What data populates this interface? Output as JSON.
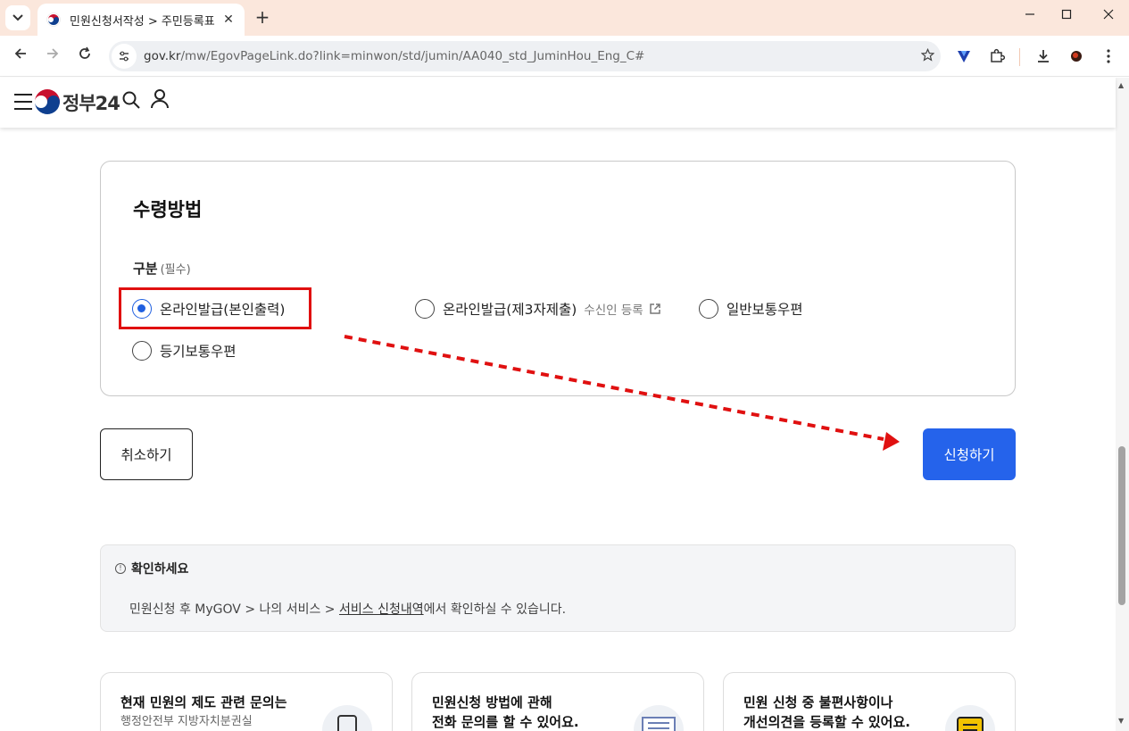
{
  "browser": {
    "tab_title": "민원신청서작성 > 주민등록표",
    "tab_close": "✕",
    "new_tab": "+",
    "url_host": "gov.kr",
    "url_path": "/mw/EgovPageLink.do?link=minwon/std/jumin/AA040_std_JuminHou_Eng_C#"
  },
  "header": {
    "logo_text": "정부24"
  },
  "receipt": {
    "title": "수령방법",
    "field_label": "구분",
    "required": "(필수)",
    "options": [
      {
        "label": "온라인발급(본인출력)",
        "checked": true
      },
      {
        "label": "온라인발급(제3자제출)",
        "sub": "수신인 등록",
        "checked": false
      },
      {
        "label": "일반보통우편",
        "checked": false
      },
      {
        "label": "등기보통우편",
        "checked": false
      }
    ]
  },
  "buttons": {
    "cancel": "취소하기",
    "submit": "신청하기"
  },
  "notice": {
    "title": "확인하세요",
    "body_prefix": "민원신청 후 MyGOV > 나의 서비스 > ",
    "body_link": "서비스 신청내역",
    "body_suffix": "에서 확인하실 수 있습니다."
  },
  "info_cards": [
    {
      "line1": "현재 민원의 제도 관련 문의는",
      "line2": "행정안전부 지방자치분권실"
    },
    {
      "line1": "민원신청 방법에 관해",
      "line2": "전화 문의를 할 수 있어요."
    },
    {
      "line1": "민원 신청 중 불편사항이나",
      "line2": "개선의견을 등록할 수 있어요."
    }
  ],
  "colors": {
    "primary": "#2563eb",
    "highlight": "#e01010",
    "tabbar": "#fbe7dc"
  }
}
